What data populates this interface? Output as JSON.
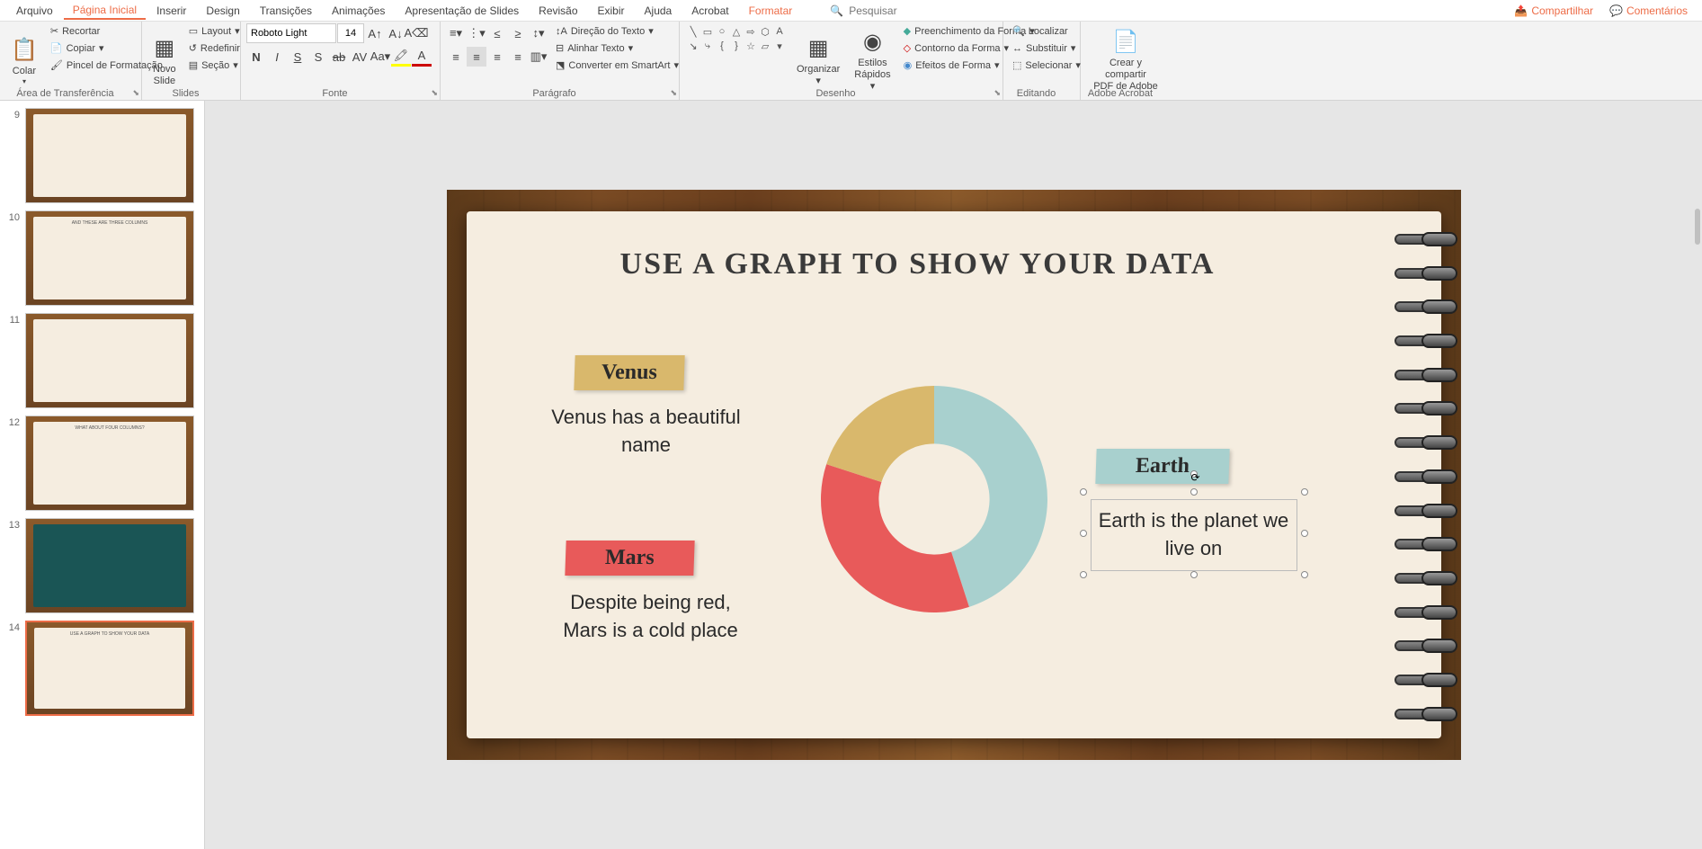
{
  "menu": {
    "items": [
      "Arquivo",
      "Página Inicial",
      "Inserir",
      "Design",
      "Transições",
      "Animações",
      "Apresentação de Slides",
      "Revisão",
      "Exibir",
      "Ajuda",
      "Acrobat",
      "Formatar"
    ],
    "search_placeholder": "Pesquisar",
    "share": "Compartilhar",
    "comments": "Comentários"
  },
  "ribbon": {
    "clipboard": {
      "label": "Área de Transferência",
      "paste": "Colar",
      "cut": "Recortar",
      "copy": "Copiar",
      "painter": "Pincel de Formatação"
    },
    "slides": {
      "label": "Slides",
      "new_slide": "Novo\nSlide",
      "layout": "Layout",
      "reset": "Redefinir",
      "section": "Seção"
    },
    "font": {
      "label": "Fonte",
      "name": "Roboto Light",
      "size": "14"
    },
    "paragraph": {
      "label": "Parágrafo",
      "text_dir": "Direção do Texto",
      "align_text": "Alinhar Texto",
      "smartart": "Converter em SmartArt"
    },
    "drawing": {
      "label": "Desenho",
      "arrange": "Organizar",
      "quick_styles": "Estilos\nRápidos",
      "fill": "Preenchimento da Forma",
      "outline": "Contorno da Forma",
      "effects": "Efeitos de Forma"
    },
    "editing": {
      "label": "Editando",
      "find": "Localizar",
      "replace": "Substituir",
      "select": "Selecionar"
    },
    "adobe": {
      "label": "Adobe Acrobat",
      "create_share": "Crear y compartir\nPDF de Adobe"
    }
  },
  "thumbnails": [
    {
      "num": "9"
    },
    {
      "num": "10"
    },
    {
      "num": "11"
    },
    {
      "num": "12"
    },
    {
      "num": "13"
    },
    {
      "num": "14"
    }
  ],
  "slide": {
    "title": "USE A GRAPH TO SHOW YOUR DATA",
    "venus_label": "Venus",
    "venus_desc": "Venus has a beautiful name",
    "mars_label": "Mars",
    "mars_desc": "Despite being red, Mars is a cold place",
    "earth_label": "Earth",
    "earth_desc": "Earth is the planet we live on"
  },
  "chart_data": {
    "type": "pie",
    "title": "",
    "series": [
      {
        "name": "Earth",
        "value": 45,
        "color": "#a8d0ce"
      },
      {
        "name": "Mars",
        "value": 35,
        "color": "#e85a5a"
      },
      {
        "name": "Venus",
        "value": 20,
        "color": "#d9b86c"
      }
    ]
  }
}
